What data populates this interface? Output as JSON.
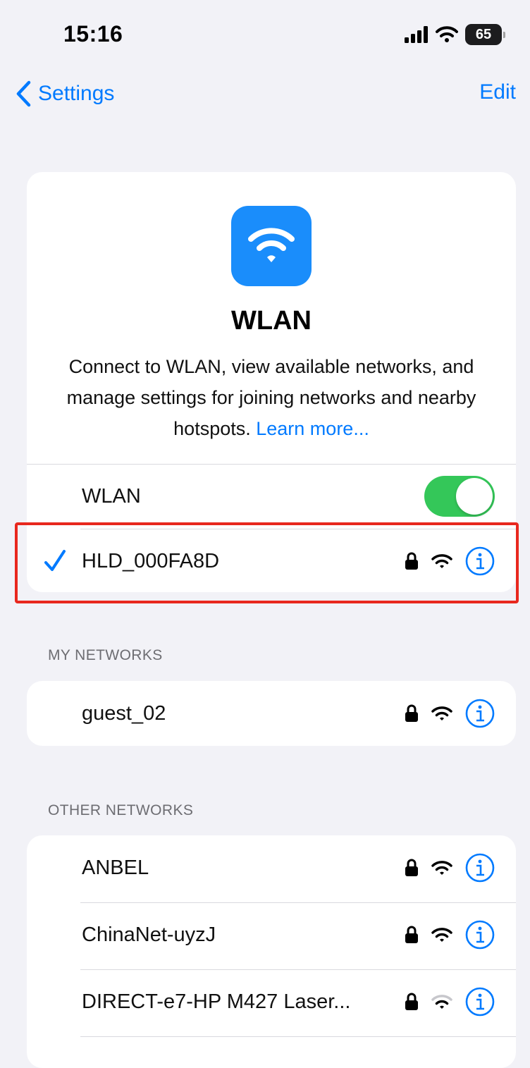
{
  "status_bar": {
    "time": "15:16",
    "battery": "65"
  },
  "nav": {
    "back_label": "Settings",
    "edit_label": "Edit"
  },
  "header": {
    "title": "WLAN",
    "description": "Connect to WLAN, view available networks, and manage settings for joining networks and nearby hotspots.",
    "learn_more": "Learn more..."
  },
  "wlan_toggle": {
    "label": "WLAN",
    "on": true
  },
  "connected_network": {
    "name": "HLD_000FA8D",
    "secured": true,
    "signal": "full"
  },
  "my_networks": {
    "header": "MY NETWORKS",
    "items": [
      {
        "name": "guest_02",
        "secured": true,
        "signal": "full"
      }
    ]
  },
  "other_networks": {
    "header": "OTHER NETWORKS",
    "items": [
      {
        "name": "ANBEL",
        "secured": true,
        "signal": "full"
      },
      {
        "name": "ChinaNet-uyzJ",
        "secured": true,
        "signal": "full"
      },
      {
        "name": "DIRECT-e7-HP M427 Laser...",
        "secured": true,
        "signal": "medium"
      }
    ]
  },
  "colors": {
    "accent": "#007aff",
    "toggle_on": "#34c759",
    "app_icon": "#1a8dfb",
    "highlight": "#e8281e",
    "background": "#f2f2f7"
  },
  "icons": [
    "chevron-left-icon",
    "wifi-icon",
    "lock-icon",
    "info-icon",
    "checkmark-icon",
    "cellular-signal-icon",
    "battery-icon"
  ]
}
